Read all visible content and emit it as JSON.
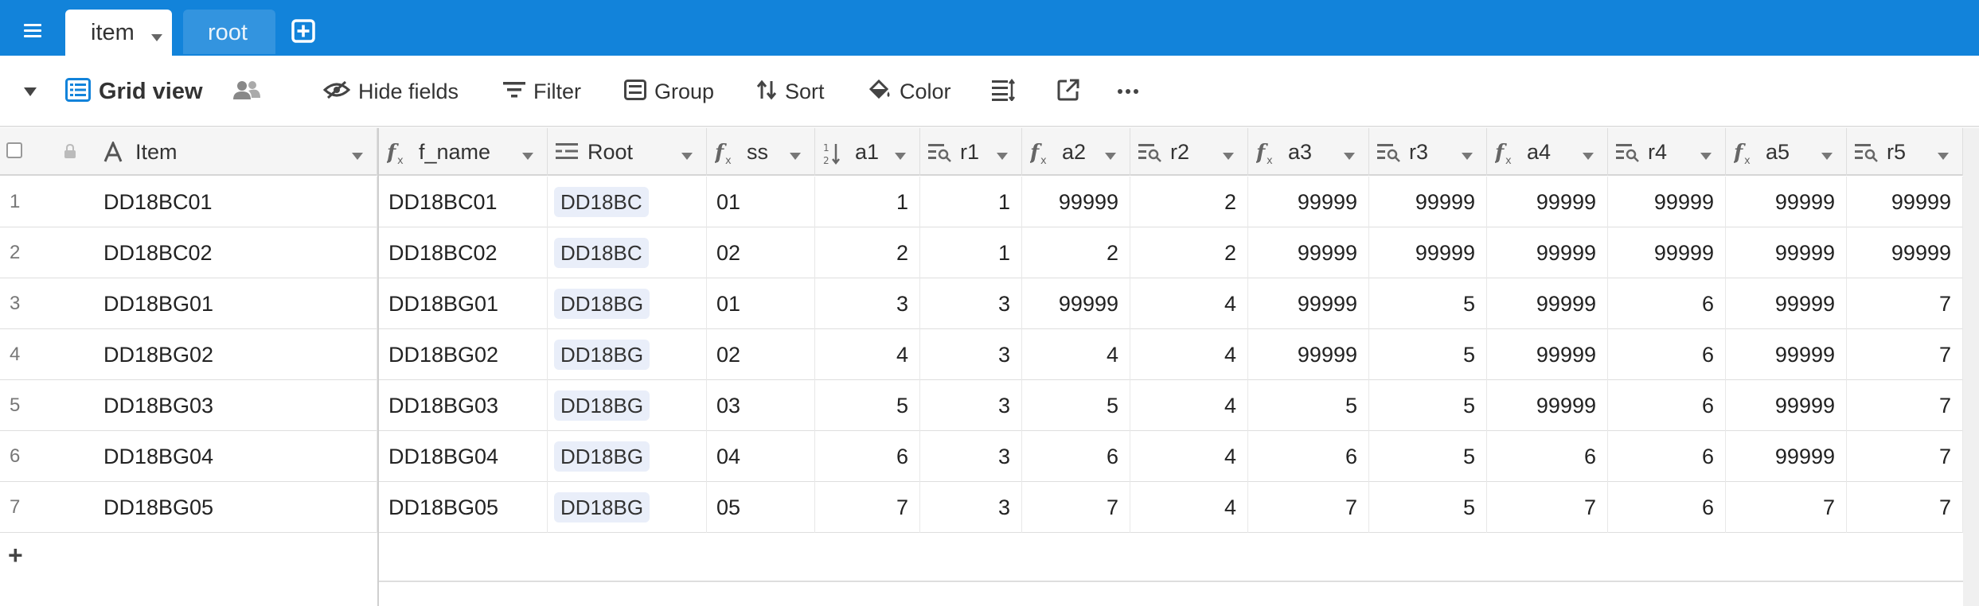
{
  "tabs": [
    {
      "label": "item",
      "active": true
    },
    {
      "label": "root",
      "active": false
    }
  ],
  "viewbar": {
    "view_name": "Grid view",
    "hide_fields": "Hide fields",
    "filter": "Filter",
    "group": "Group",
    "sort": "Sort",
    "color": "Color"
  },
  "colors": {
    "topbar": "#1283da",
    "accent_icon": "#1283da",
    "chip_bg": "#e9eef9"
  },
  "columns": [
    {
      "key": "item",
      "label": "Item",
      "icon": "text-icon"
    },
    {
      "key": "f_name",
      "label": "f_name",
      "icon": "formula-icon"
    },
    {
      "key": "root",
      "label": "Root",
      "icon": "link-icon"
    },
    {
      "key": "ss",
      "label": "ss",
      "icon": "formula-icon"
    },
    {
      "key": "a1",
      "label": "a1",
      "icon": "number-icon"
    },
    {
      "key": "r1",
      "label": "r1",
      "icon": "lookup-icon"
    },
    {
      "key": "a2",
      "label": "a2",
      "icon": "formula-icon"
    },
    {
      "key": "r2",
      "label": "r2",
      "icon": "lookup-icon"
    },
    {
      "key": "a3",
      "label": "a3",
      "icon": "formula-icon"
    },
    {
      "key": "r3",
      "label": "r3",
      "icon": "lookup-icon"
    },
    {
      "key": "a4",
      "label": "a4",
      "icon": "formula-icon"
    },
    {
      "key": "r4",
      "label": "r4",
      "icon": "lookup-icon"
    },
    {
      "key": "a5",
      "label": "a5",
      "icon": "formula-icon"
    },
    {
      "key": "r5",
      "label": "r5",
      "icon": "lookup-icon"
    }
  ],
  "rows": [
    {
      "n": "1",
      "item": "DD18BC01",
      "f_name": "DD18BC01",
      "root": "DD18BC",
      "ss": "01",
      "a1": "1",
      "r1": "1",
      "a2": "99999",
      "r2": "2",
      "a3": "99999",
      "r3": "99999",
      "a4": "99999",
      "r4": "99999",
      "a5": "99999",
      "r5": "99999"
    },
    {
      "n": "2",
      "item": "DD18BC02",
      "f_name": "DD18BC02",
      "root": "DD18BC",
      "ss": "02",
      "a1": "2",
      "r1": "1",
      "a2": "2",
      "r2": "2",
      "a3": "99999",
      "r3": "99999",
      "a4": "99999",
      "r4": "99999",
      "a5": "99999",
      "r5": "99999"
    },
    {
      "n": "3",
      "item": "DD18BG01",
      "f_name": "DD18BG01",
      "root": "DD18BG",
      "ss": "01",
      "a1": "3",
      "r1": "3",
      "a2": "99999",
      "r2": "4",
      "a3": "99999",
      "r3": "5",
      "a4": "99999",
      "r4": "6",
      "a5": "99999",
      "r5": "7"
    },
    {
      "n": "4",
      "item": "DD18BG02",
      "f_name": "DD18BG02",
      "root": "DD18BG",
      "ss": "02",
      "a1": "4",
      "r1": "3",
      "a2": "4",
      "r2": "4",
      "a3": "99999",
      "r3": "5",
      "a4": "99999",
      "r4": "6",
      "a5": "99999",
      "r5": "7"
    },
    {
      "n": "5",
      "item": "DD18BG03",
      "f_name": "DD18BG03",
      "root": "DD18BG",
      "ss": "03",
      "a1": "5",
      "r1": "3",
      "a2": "5",
      "r2": "4",
      "a3": "5",
      "r3": "5",
      "a4": "99999",
      "r4": "6",
      "a5": "99999",
      "r5": "7"
    },
    {
      "n": "6",
      "item": "DD18BG04",
      "f_name": "DD18BG04",
      "root": "DD18BG",
      "ss": "04",
      "a1": "6",
      "r1": "3",
      "a2": "6",
      "r2": "4",
      "a3": "6",
      "r3": "5",
      "a4": "6",
      "r4": "6",
      "a5": "99999",
      "r5": "7"
    },
    {
      "n": "7",
      "item": "DD18BG05",
      "f_name": "DD18BG05",
      "root": "DD18BG",
      "ss": "05",
      "a1": "7",
      "r1": "3",
      "a2": "7",
      "r2": "4",
      "a3": "7",
      "r3": "5",
      "a4": "7",
      "r4": "6",
      "a5": "7",
      "r5": "7"
    }
  ],
  "add_row_label": "+"
}
